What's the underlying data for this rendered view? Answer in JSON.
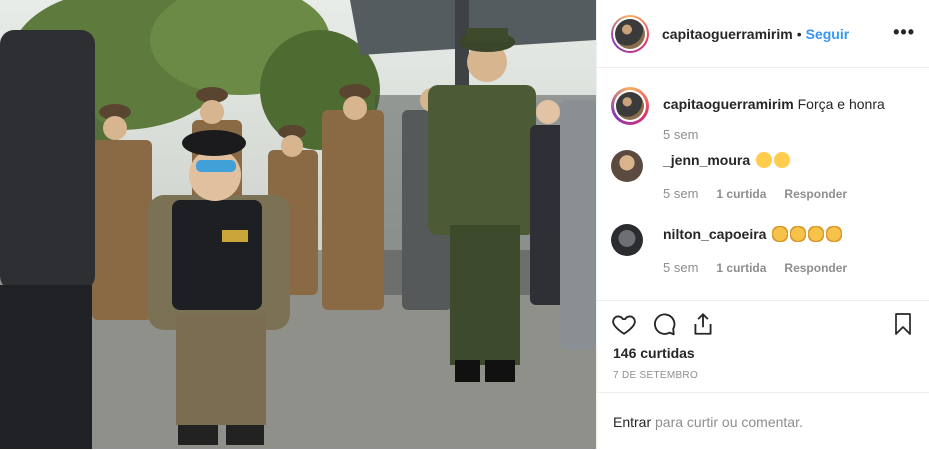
{
  "post": {
    "author": "capitaoguerramirim",
    "dot": "•",
    "follow_label": "Seguir",
    "more_label": "•••",
    "caption": {
      "username": "capitaoguerramirim",
      "text": "Força e honra",
      "time": "5 sem"
    },
    "comments": [
      {
        "username": "_jenn_moura",
        "emoji": "heart-eyes",
        "emoji_count": 2,
        "time": "5 sem",
        "likes": "",
        "reply": "Responder"
      },
      {
        "username": "nilton_capoeira",
        "emoji": "clap",
        "emoji_count": 4,
        "time": "5 sem",
        "likes": "1 curtida",
        "reply": "Responder"
      }
    ],
    "first_comment_likes": "1 curtida",
    "likes_count": "146 curtidas",
    "date": "7 DE SETEMBRO",
    "footer": {
      "login": "Entrar",
      "rest": " para curtir ou comentar."
    }
  },
  "icons": [
    "heart-icon",
    "comment-icon",
    "share-icon",
    "bookmark-icon"
  ],
  "colors": {
    "accent": "#3897f0",
    "muted": "#8e8e8e",
    "text": "#262626",
    "border": "#efefef"
  }
}
